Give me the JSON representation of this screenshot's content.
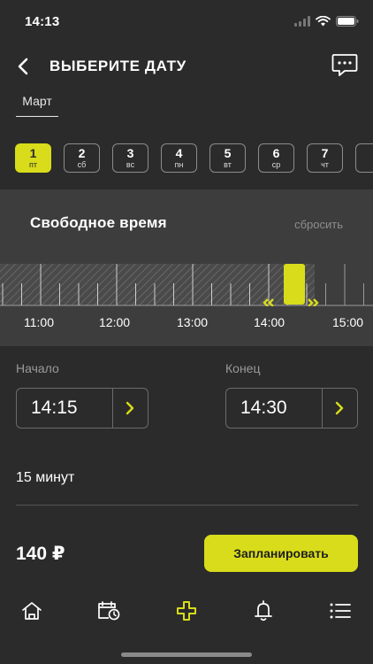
{
  "status_bar": {
    "time": "14:13"
  },
  "header": {
    "title": "ВЫБЕРИТЕ ДАТУ",
    "back_icon": "chevron-left-icon",
    "chat_icon": "chat-bubble-icon"
  },
  "month": {
    "label": "Март"
  },
  "days": [
    {
      "num": "1",
      "dow": "пт",
      "active": true
    },
    {
      "num": "2",
      "dow": "сб",
      "active": false
    },
    {
      "num": "3",
      "dow": "вс",
      "active": false
    },
    {
      "num": "4",
      "dow": "пн",
      "active": false
    },
    {
      "num": "5",
      "dow": "вт",
      "active": false
    },
    {
      "num": "6",
      "dow": "ср",
      "active": false
    },
    {
      "num": "7",
      "dow": "чт",
      "active": false
    }
  ],
  "free_time": {
    "title": "Свободное время",
    "reset_label": "сбросить",
    "hour_labels": [
      "11:00",
      "12:00",
      "13:00",
      "14:00",
      "15:00"
    ],
    "selection_start": "14:15",
    "selection_end": "14:30"
  },
  "start": {
    "label": "Начало",
    "value": "14:15"
  },
  "end": {
    "label": "Конец",
    "value": "14:30"
  },
  "duration": "15 минут",
  "price": "140 ₽",
  "plan_button": "Запланировать",
  "colors": {
    "accent": "#d8dc1a",
    "background": "#2b2b2b",
    "panel": "#3d3d3d"
  },
  "nav": [
    "home-icon",
    "calendar-clock-icon",
    "plus-icon",
    "bell-icon",
    "menu-icon"
  ]
}
